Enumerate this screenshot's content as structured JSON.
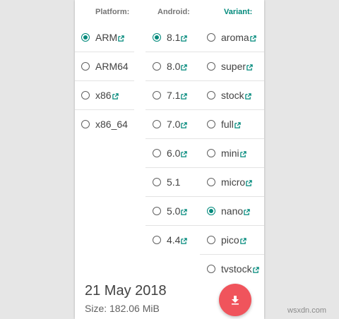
{
  "headers": {
    "platform": "Platform:",
    "android": "Android:",
    "variant": "Variant:"
  },
  "platforms": [
    {
      "label": "ARM",
      "checked": true,
      "link": true
    },
    {
      "label": "ARM64",
      "checked": false,
      "link": false
    },
    {
      "label": "x86",
      "checked": false,
      "link": true
    },
    {
      "label": "x86_64",
      "checked": false,
      "link": false
    }
  ],
  "android": [
    {
      "label": "8.1",
      "checked": true,
      "link": true
    },
    {
      "label": "8.0",
      "checked": false,
      "link": true
    },
    {
      "label": "7.1",
      "checked": false,
      "link": true
    },
    {
      "label": "7.0",
      "checked": false,
      "link": true
    },
    {
      "label": "6.0",
      "checked": false,
      "link": true
    },
    {
      "label": "5.1",
      "checked": false,
      "link": false
    },
    {
      "label": "5.0",
      "checked": false,
      "link": true
    },
    {
      "label": "4.4",
      "checked": false,
      "link": true
    }
  ],
  "variants": [
    {
      "label": "aroma",
      "checked": false,
      "link": true
    },
    {
      "label": "super",
      "checked": false,
      "link": true
    },
    {
      "label": "stock",
      "checked": false,
      "link": true
    },
    {
      "label": "full",
      "checked": false,
      "link": true
    },
    {
      "label": "mini",
      "checked": false,
      "link": true
    },
    {
      "label": "micro",
      "checked": false,
      "link": true
    },
    {
      "label": "nano",
      "checked": true,
      "link": true
    },
    {
      "label": "pico",
      "checked": false,
      "link": true
    },
    {
      "label": "tvstock",
      "checked": false,
      "link": true
    }
  ],
  "release": {
    "date": "21 May 2018",
    "size": "Size: 182.06 MiB"
  },
  "download": {
    "icon": "download-icon",
    "color": "#f0545c"
  },
  "colors": {
    "accent": "#00897b",
    "text": "#424242"
  },
  "watermark": "wsxdn.com"
}
